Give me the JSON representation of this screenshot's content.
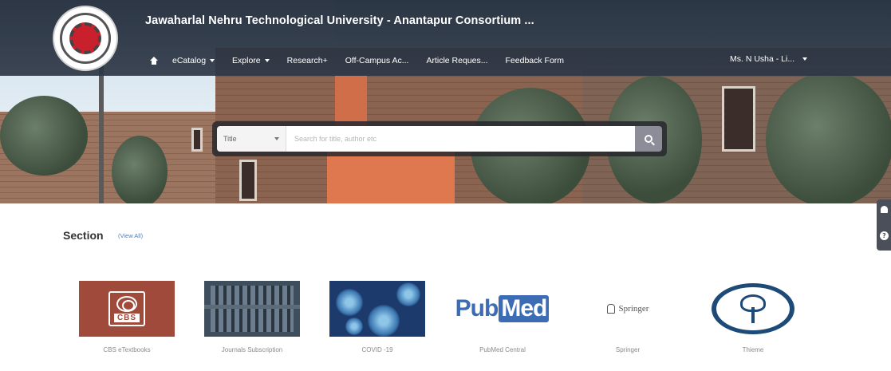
{
  "header": {
    "site_title": "Jawaharlal Nehru Technological University - Anantapur Consortium ...",
    "logo_icon": "university-seal-icon"
  },
  "nav": {
    "home_icon": "home-icon",
    "items": [
      {
        "label": "eCatalog",
        "has_dropdown": true
      },
      {
        "label": "Explore",
        "has_dropdown": true
      },
      {
        "label": "Research+",
        "has_dropdown": false
      },
      {
        "label": "Off-Campus Ac...",
        "has_dropdown": false
      },
      {
        "label": "Article Reques...",
        "has_dropdown": false
      },
      {
        "label": "Feedback Form",
        "has_dropdown": false
      }
    ],
    "user_label": "Ms. N Usha - Li..."
  },
  "search": {
    "field_selected": "Title",
    "placeholder": "Search for title, author etc",
    "button_icon": "search-icon"
  },
  "section": {
    "title": "Section",
    "view_all_label": "(View All)"
  },
  "tiles": [
    {
      "label": "CBS eTextbooks",
      "logo_text": "CBS"
    },
    {
      "label": "Journals Subscription"
    },
    {
      "label": "COVID -19"
    },
    {
      "label": "PubMed Central",
      "logo_text_a": "Pub",
      "logo_text_b": "Med"
    },
    {
      "label": "Springer",
      "logo_text": "Springer"
    },
    {
      "label": "Thieme"
    }
  ],
  "side_tabs": {
    "bell_icon": "bell-icon",
    "help_icon": "help-icon",
    "help_glyph": "?"
  },
  "colors": {
    "nav_bg": "#2d3746",
    "accent_blue": "#3c6db4",
    "cbs_red": "#a04a3c",
    "thieme_blue": "#1e4a78"
  }
}
